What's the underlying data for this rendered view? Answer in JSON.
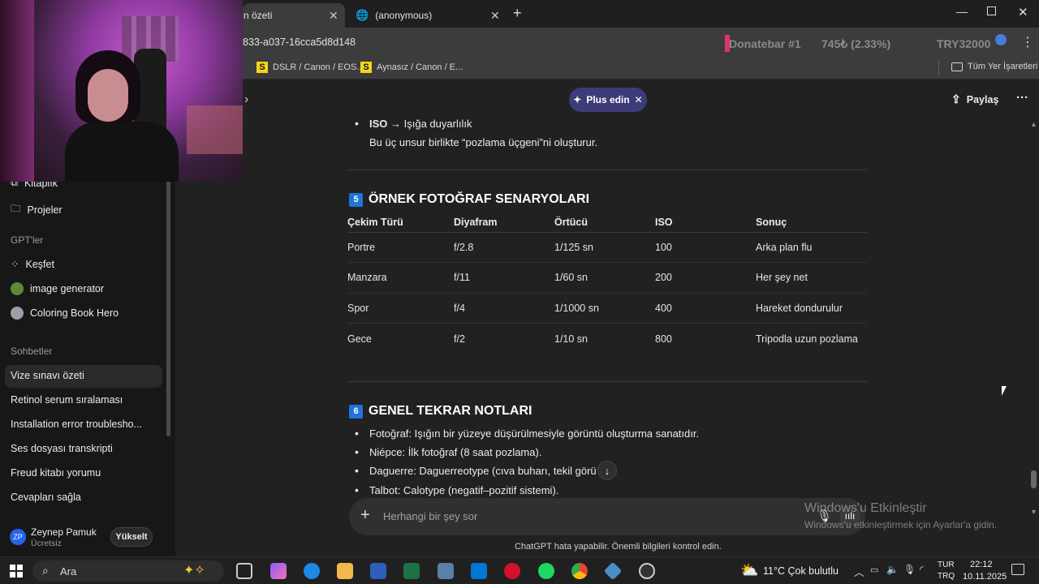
{
  "tabs": [
    {
      "label": "n özeti"
    },
    {
      "label": "(anonymous)"
    }
  ],
  "address": {
    "url_fragment": "833-a037-16cca5d8d148"
  },
  "donatebar": {
    "text": "Donatebar #1",
    "amount": "745₺ (2.33%)",
    "goal": "TRY32000"
  },
  "bookmarks": [
    {
      "label": "DSLR / Canon / EOS..."
    },
    {
      "label": "Aynasız / Canon / E..."
    }
  ],
  "all_bookmarks": "Tüm Yer İşaretleri",
  "header": {
    "plus_label": "Plus edin",
    "share_label": "Paylaş"
  },
  "sidebar": {
    "top_items": [
      {
        "label": "Kitaplık"
      },
      {
        "label": "Projeler"
      }
    ],
    "gpts_heading": "GPT'ler",
    "gpts": [
      {
        "label": "Keşfet"
      },
      {
        "label": "image generator"
      },
      {
        "label": "Coloring Book Hero"
      }
    ],
    "chats_heading": "Sohbetler",
    "chats": [
      {
        "label": "Vize sınavı özeti"
      },
      {
        "label": "Retinol serum sıralaması"
      },
      {
        "label": "Installation error troublesho..."
      },
      {
        "label": "Ses dosyası transkripti"
      },
      {
        "label": "Freud kitabı yorumu"
      },
      {
        "label": "Cevapları sağla"
      }
    ],
    "user": {
      "initials": "ZP",
      "name": "Zeynep Pamuk",
      "plan": "Ücretsiz",
      "upgrade": "Yükselt"
    }
  },
  "content": {
    "iso_bold": "ISO",
    "iso_rest": " → Işığa duyarlılık",
    "iso_note": "Bu üç unsur birlikte “pozlama üçgeni”ni oluşturur.",
    "section5": {
      "num": "5",
      "title": "ÖRNEK FOTOĞRAF SENARYOLARI"
    },
    "table": {
      "headers": [
        "Çekim Türü",
        "Diyafram",
        "Örtücü",
        "ISO",
        "Sonuç"
      ],
      "rows": [
        [
          "Portre",
          "f/2.8",
          "1/125 sn",
          "100",
          "Arka plan flu"
        ],
        [
          "Manzara",
          "f/11",
          "1/60 sn",
          "200",
          "Her şey net"
        ],
        [
          "Spor",
          "f/4",
          "1/1000 sn",
          "400",
          "Hareket dondurulur"
        ],
        [
          "Gece",
          "f/2",
          "1/10 sn",
          "800",
          "Tripodla uzun pozlama"
        ]
      ]
    },
    "section6": {
      "num": "6",
      "title": "GENEL TEKRAR NOTLARI"
    },
    "notes": [
      "Fotoğraf: Işığın bir yüzeye düşürülmesiyle görüntü oluşturma sanatıdır.",
      "Niépce: İlk fotoğraf (8 saat pozlama).",
      "Daguerre: Daguerreotype (cıva buharı, tekil görü      ).",
      "Talbot: Calotype (negatif–pozitif sistemi)."
    ]
  },
  "composer": {
    "placeholder": "Herhangi bir şey sor"
  },
  "disclaimer": "ChatGPT hata yapabilir. Önemli bilgileri kontrol edin.",
  "activation": {
    "title": "Windows'u Etkinleştir",
    "subtitle": "Windows'u etkinleştirmek için Ayarlar'a gidin."
  },
  "taskbar": {
    "search": "Ara",
    "weather": "11°C  Çok bulutlu",
    "lang": "TUR",
    "lang2": "TRQ",
    "time": "22:12",
    "date": "10.11.2025"
  }
}
